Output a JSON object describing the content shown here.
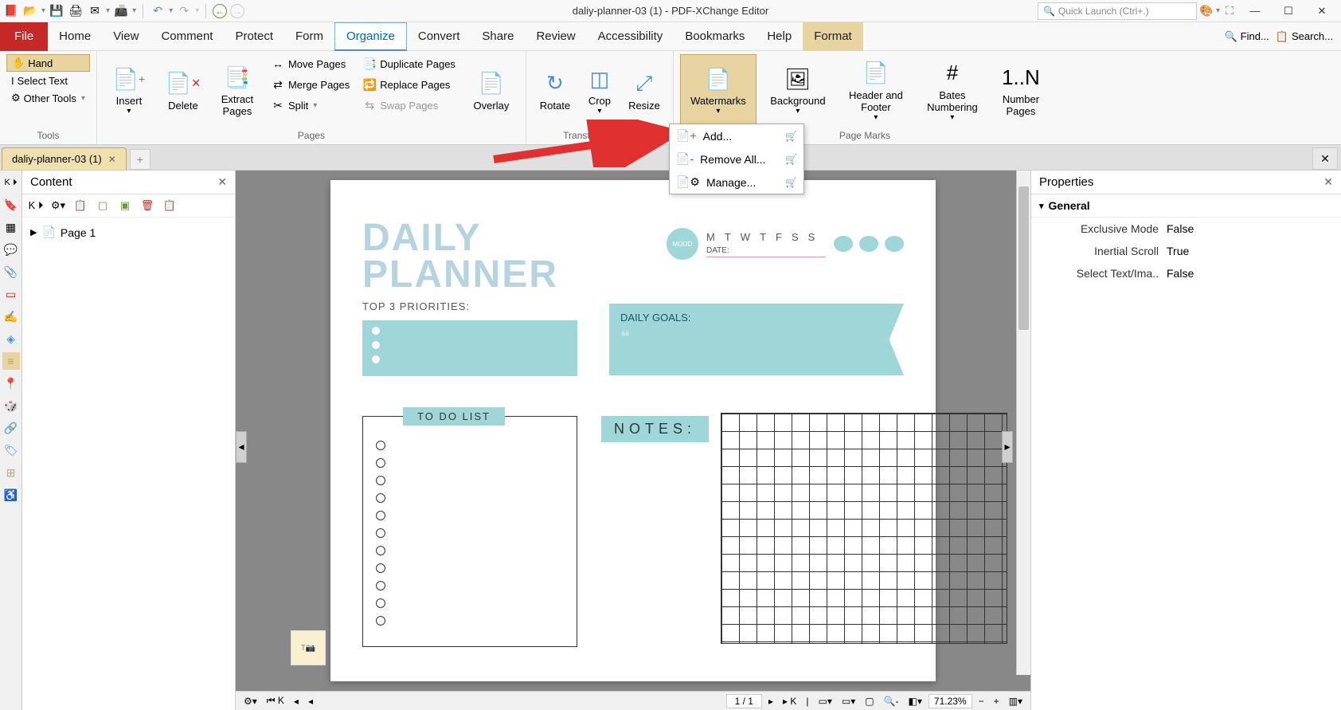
{
  "app": {
    "title": "daliy-planner-03 (1) - PDF-XChange Editor",
    "quick_launch_placeholder": "Quick Launch (Ctrl+.)"
  },
  "menu": {
    "file": "File",
    "items": [
      "Home",
      "View",
      "Comment",
      "Protect",
      "Form",
      "Organize",
      "Convert",
      "Share",
      "Review",
      "Accessibility",
      "Bookmarks",
      "Help",
      "Format"
    ],
    "active": "Organize",
    "find": "Find...",
    "search": "Search..."
  },
  "ribbon": {
    "tools": {
      "label": "Tools",
      "hand": "Hand",
      "select_text": "Select Text",
      "other_tools": "Other Tools"
    },
    "pages": {
      "label": "Pages",
      "insert": "Insert",
      "delete": "Delete",
      "extract": "Extract Pages",
      "move": "Move Pages",
      "merge": "Merge Pages",
      "split": "Split",
      "duplicate": "Duplicate Pages",
      "replace": "Replace Pages",
      "swap": "Swap Pages"
    },
    "transform": {
      "label": "Transform Pages",
      "overlay": "Overlay",
      "rotate": "Rotate",
      "crop": "Crop",
      "resize": "Resize"
    },
    "pagemarks": {
      "label": "Page Marks",
      "watermarks": "Watermarks",
      "background": "Background",
      "header_footer": "Header and Footer",
      "bates": "Bates Numbering",
      "number_pages": "Number Pages"
    }
  },
  "dropdown": {
    "add": "Add...",
    "remove": "Remove All...",
    "manage": "Manage..."
  },
  "tab": {
    "name": "daliy-planner-03 (1)"
  },
  "content_panel": {
    "title": "Content",
    "page1": "Page 1"
  },
  "properties": {
    "title": "Properties",
    "general": "General",
    "rows": [
      {
        "label": "Exclusive Mode",
        "value": "False"
      },
      {
        "label": "Inertial Scroll",
        "value": "True"
      },
      {
        "label": "Select Text/Ima..",
        "value": "False"
      }
    ]
  },
  "statusbar": {
    "page": "1 / 1",
    "zoom": "71.23%"
  },
  "planner": {
    "title1": "DAILY",
    "title2": "PLANNER",
    "priorities": "TOP 3 PRIORITIES:",
    "goals": "DAILY GOALS:",
    "todo": "TO DO LIST",
    "notes": "NOTES:",
    "mood": "MOOD",
    "date": "DATE:",
    "days": [
      "M",
      "T",
      "W",
      "T",
      "F",
      "S",
      "S"
    ]
  }
}
